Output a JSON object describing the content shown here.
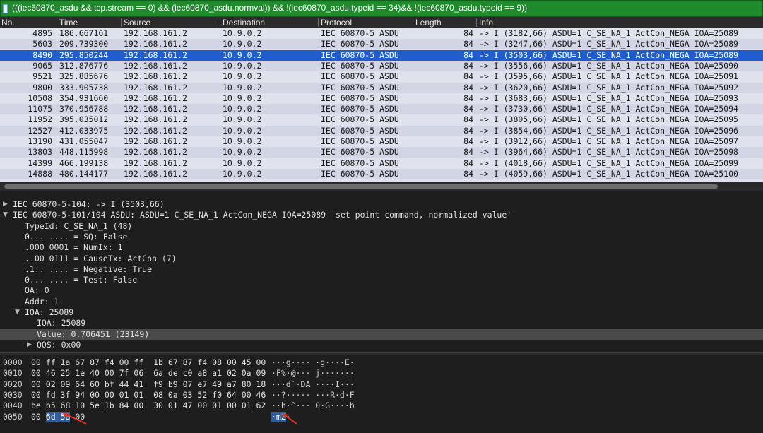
{
  "filter": {
    "expression": "(((iec60870_asdu && tcp.stream == 0) && (iec60870_asdu.normval)) && !(iec60870_asdu.typeid == 34)&& !(iec60870_asdu.typeid == 9))"
  },
  "columns": [
    "No.",
    "Time",
    "Source",
    "Destination",
    "Protocol",
    "Length",
    "Info"
  ],
  "packets": [
    {
      "no": "4895",
      "time": "186.667161",
      "src": "192.168.161.2",
      "dst": "10.9.0.2",
      "proto": "IEC 60870-5 ASDU",
      "len": "84",
      "info": "-> I (3182,66) ASDU=1 C_SE_NA_1 ActCon_NEGA IOA=25089"
    },
    {
      "no": "5603",
      "time": "209.739300",
      "src": "192.168.161.2",
      "dst": "10.9.0.2",
      "proto": "IEC 60870-5 ASDU",
      "len": "84",
      "info": "-> I (3247,66) ASDU=1 C_SE_NA_1 ActCon_NEGA IOA=25089"
    },
    {
      "no": "8490",
      "time": "295.850244",
      "src": "192.168.161.2",
      "dst": "10.9.0.2",
      "proto": "IEC 60870-5 ASDU",
      "len": "84",
      "info": "-> I (3503,66) ASDU=1 C_SE_NA_1 ActCon_NEGA IOA=25089"
    },
    {
      "no": "9065",
      "time": "312.876776",
      "src": "192.168.161.2",
      "dst": "10.9.0.2",
      "proto": "IEC 60870-5 ASDU",
      "len": "84",
      "info": "-> I (3556,66) ASDU=1 C_SE_NA_1 ActCon_NEGA IOA=25090"
    },
    {
      "no": "9521",
      "time": "325.885676",
      "src": "192.168.161.2",
      "dst": "10.9.0.2",
      "proto": "IEC 60870-5 ASDU",
      "len": "84",
      "info": "-> I (3595,66) ASDU=1 C_SE_NA_1 ActCon_NEGA IOA=25091"
    },
    {
      "no": "9800",
      "time": "333.905738",
      "src": "192.168.161.2",
      "dst": "10.9.0.2",
      "proto": "IEC 60870-5 ASDU",
      "len": "84",
      "info": "-> I (3620,66) ASDU=1 C_SE_NA_1 ActCon_NEGA IOA=25092"
    },
    {
      "no": "10508",
      "time": "354.931660",
      "src": "192.168.161.2",
      "dst": "10.9.0.2",
      "proto": "IEC 60870-5 ASDU",
      "len": "84",
      "info": "-> I (3683,66) ASDU=1 C_SE_NA_1 ActCon_NEGA IOA=25093"
    },
    {
      "no": "11075",
      "time": "370.956788",
      "src": "192.168.161.2",
      "dst": "10.9.0.2",
      "proto": "IEC 60870-5 ASDU",
      "len": "84",
      "info": "-> I (3730,66) ASDU=1 C_SE_NA_1 ActCon_NEGA IOA=25094"
    },
    {
      "no": "11952",
      "time": "395.035012",
      "src": "192.168.161.2",
      "dst": "10.9.0.2",
      "proto": "IEC 60870-5 ASDU",
      "len": "84",
      "info": "-> I (3805,66) ASDU=1 C_SE_NA_1 ActCon_NEGA IOA=25095"
    },
    {
      "no": "12527",
      "time": "412.033975",
      "src": "192.168.161.2",
      "dst": "10.9.0.2",
      "proto": "IEC 60870-5 ASDU",
      "len": "84",
      "info": "-> I (3854,66) ASDU=1 C_SE_NA_1 ActCon_NEGA IOA=25096"
    },
    {
      "no": "13190",
      "time": "431.055047",
      "src": "192.168.161.2",
      "dst": "10.9.0.2",
      "proto": "IEC 60870-5 ASDU",
      "len": "84",
      "info": "-> I (3912,66) ASDU=1 C_SE_NA_1 ActCon_NEGA IOA=25097"
    },
    {
      "no": "13803",
      "time": "448.115998",
      "src": "192.168.161.2",
      "dst": "10.9.0.2",
      "proto": "IEC 60870-5 ASDU",
      "len": "84",
      "info": "-> I (3964,66) ASDU=1 C_SE_NA_1 ActCon_NEGA IOA=25098"
    },
    {
      "no": "14399",
      "time": "466.199138",
      "src": "192.168.161.2",
      "dst": "10.9.0.2",
      "proto": "IEC 60870-5 ASDU",
      "len": "84",
      "info": "-> I (4018,66) ASDU=1 C_SE_NA_1 ActCon_NEGA IOA=25099"
    },
    {
      "no": "14888",
      "time": "480.144177",
      "src": "192.168.161.2",
      "dst": "10.9.0.2",
      "proto": "IEC 60870-5 ASDU",
      "len": "84",
      "info": "-> I (4059,66) ASDU=1 C_SE_NA_1 ActCon_NEGA IOA=25100"
    }
  ],
  "selected_packet": "8490",
  "details": [
    {
      "text": "IEC 60870-5-104: -> I (3503,66)",
      "state": "collapsed"
    },
    {
      "text": "IEC 60870-5-101/104 ASDU: ASDU=1 C_SE_NA_1 ActCon_NEGA IOA=25089 'set point command, normalized value'",
      "state": "expanded"
    },
    {
      "text": "TypeId: C_SE_NA_1 (48)",
      "state": "leaf"
    },
    {
      "text": "0... .... = SQ: False",
      "state": "leaf"
    },
    {
      "text": ".000 0001 = NumIx: 1",
      "state": "leaf"
    },
    {
      "text": "..00 0111 = CauseTx: ActCon (7)",
      "state": "leaf"
    },
    {
      "text": ".1.. .... = Negative: True",
      "state": "leaf"
    },
    {
      "text": "0... .... = Test: False",
      "state": "leaf"
    },
    {
      "text": "OA: 0",
      "state": "leaf"
    },
    {
      "text": "Addr: 1",
      "state": "leaf"
    },
    {
      "text": "IOA: 25089",
      "state": "expanded"
    },
    {
      "text": "IOA: 25089",
      "state": "leaf"
    },
    {
      "text": "Value: 0.706451 (23149)",
      "state": "leaf-selected"
    },
    {
      "text": "QOS: 0x00",
      "state": "collapsed"
    }
  ],
  "bytes": [
    {
      "off": "0000",
      "hex": "00 ff 1a 67 87 f4 00 ff  1b 67 87 f4 08 00 45 00",
      "ascii": "···g···· ·g····E·"
    },
    {
      "off": "0010",
      "hex": "00 46 25 1e 40 00 7f 06  6a de c0 a8 a1 02 0a 09",
      "ascii": "·F%·@··· j·······"
    },
    {
      "off": "0020",
      "hex": "00 02 09 64 60 bf 44 41  f9 b9 07 e7 49 a7 80 18",
      "ascii": "···d`·DA ····I···"
    },
    {
      "off": "0030",
      "hex": "00 fd 3f 94 00 00 01 01  08 0a 03 52 f0 64 00 46",
      "ascii": "··?····· ···R·d·F"
    },
    {
      "off": "0040",
      "hex": "be b5 68 10 5e 1b 84 00  30 01 47 00 01 00 01 62",
      "ascii": "··h·^··· 0·G····b"
    },
    {
      "off": "0050",
      "hex_pre": "00 ",
      "hex_hl": "6d 5a",
      "hex_post": " 00",
      "ascii_hl": "·mZ",
      "ascii_post": "·"
    }
  ],
  "annotation_color": "#e8321e"
}
